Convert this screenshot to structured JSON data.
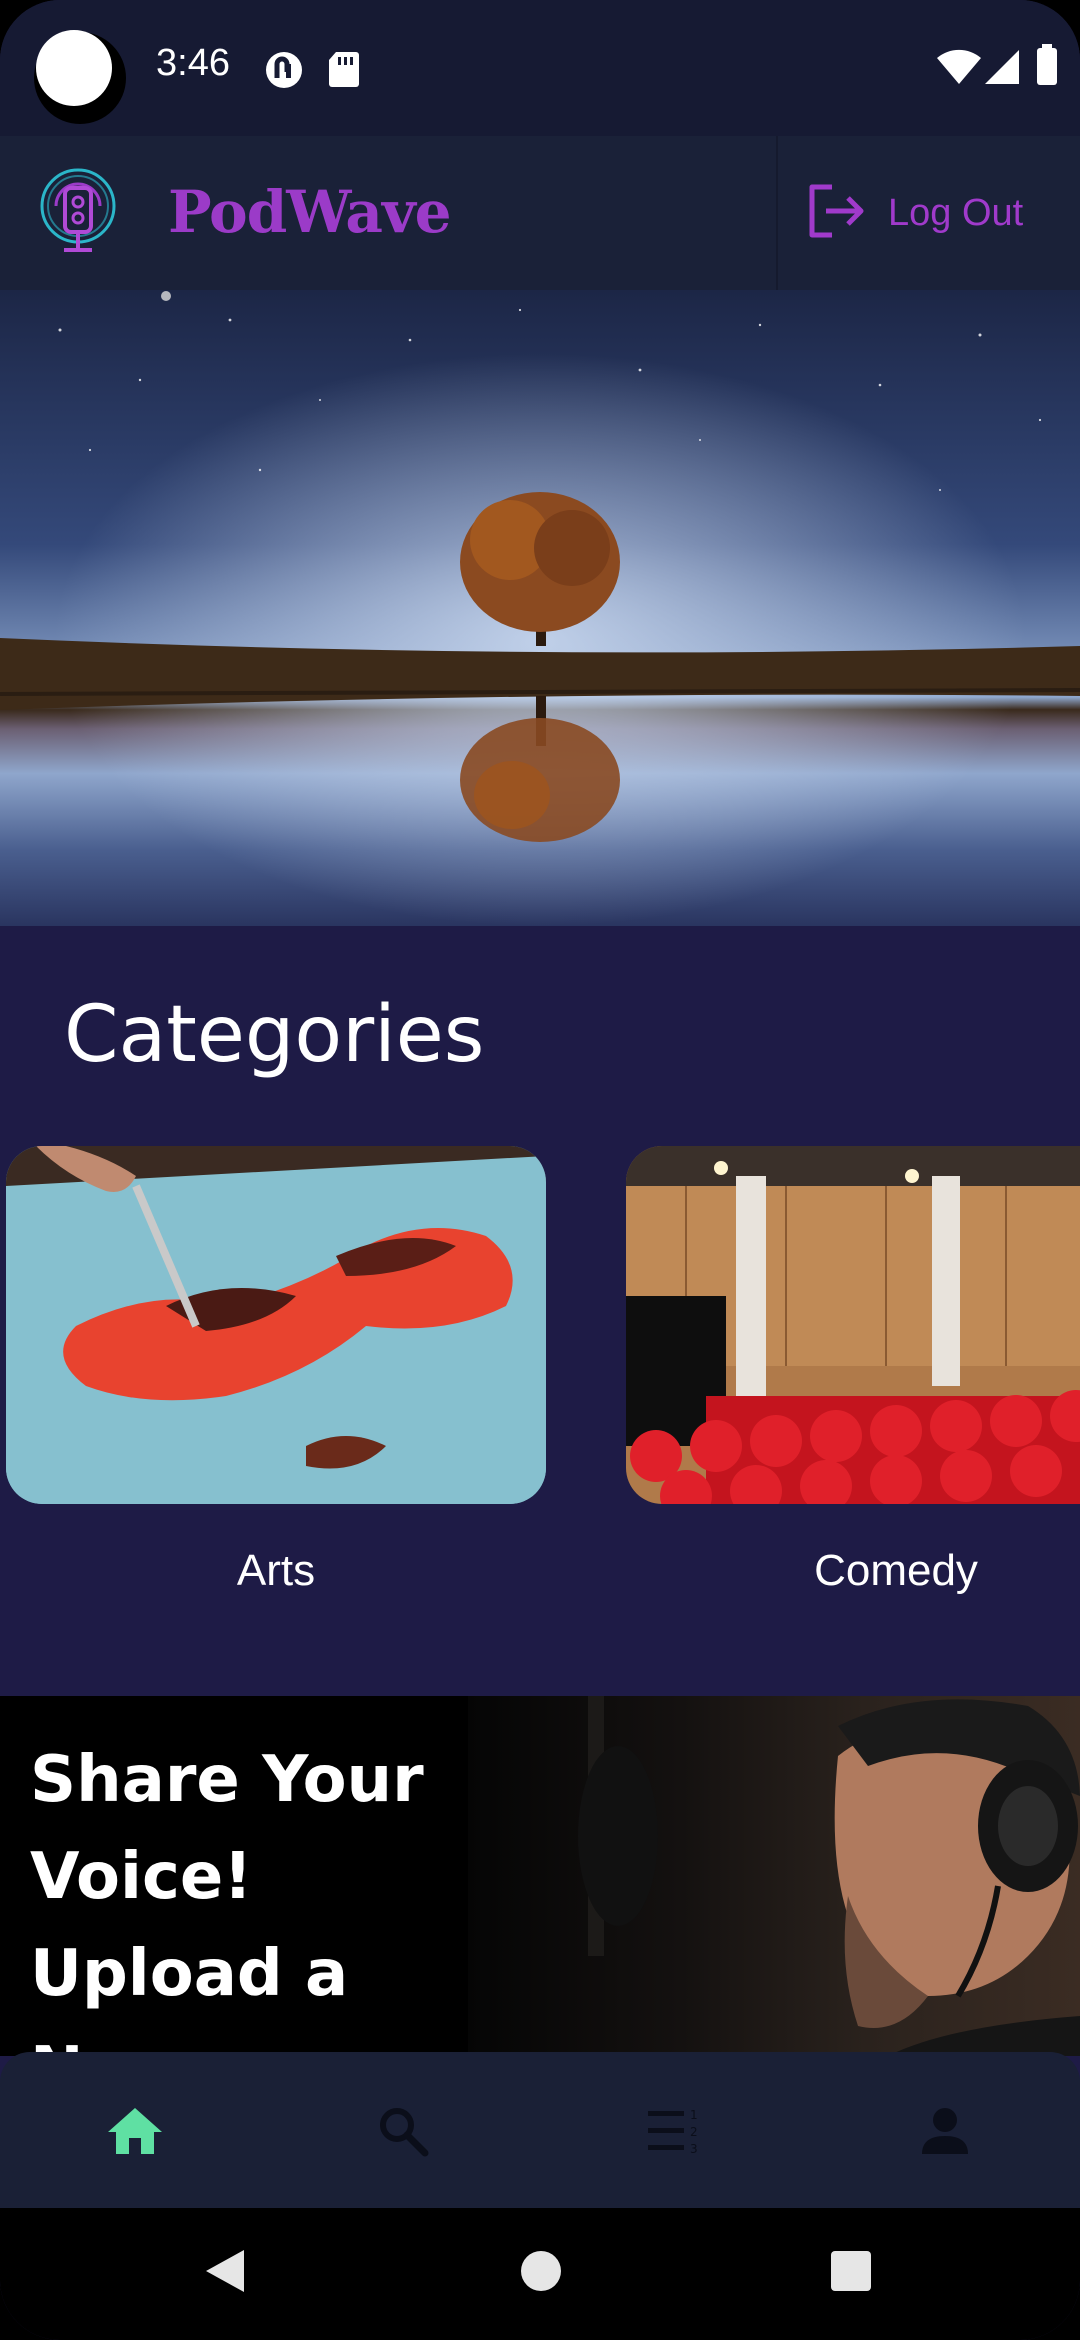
{
  "status_bar": {
    "time": "3:46",
    "icons": [
      "notification-app-icon",
      "sd-card-icon",
      "wifi-icon",
      "cellular-signal-icon",
      "battery-icon"
    ]
  },
  "header": {
    "brand": "PodWave",
    "logout_label": "Log Out",
    "accent_color": "#9b3bc8",
    "icons": [
      "podcast-logo-icon",
      "logout-icon"
    ]
  },
  "hero": {
    "image": "tree-reflection-night-sky"
  },
  "categories": {
    "title": "Categories",
    "items": [
      {
        "label": "Arts",
        "image": "painting-palette-knife"
      },
      {
        "label": "Comedy",
        "image": "theater-red-seats"
      }
    ]
  },
  "promo": {
    "text": "Share Your Voice! Upload a New Podcast",
    "image": "man-with-headphones-microphone"
  },
  "bottom_nav": {
    "items": [
      {
        "icon": "home-icon",
        "active": true
      },
      {
        "icon": "search-icon",
        "active": false
      },
      {
        "icon": "playlist-icon",
        "active": false
      },
      {
        "icon": "profile-icon",
        "active": false
      }
    ],
    "active_color": "#5fe0a3",
    "inactive_color": "#0b0e1a"
  },
  "system_nav": {
    "icons": [
      "back-icon",
      "home-circle-icon",
      "recents-icon"
    ]
  }
}
